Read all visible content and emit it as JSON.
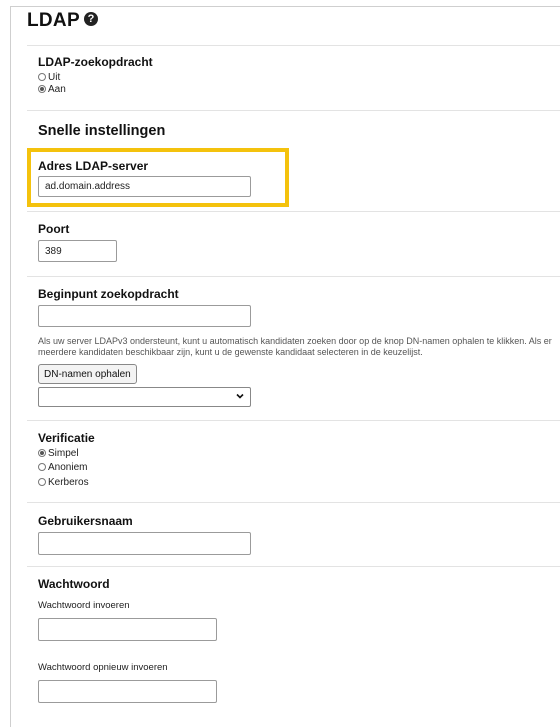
{
  "page": {
    "title": "LDAP"
  },
  "ldap_search": {
    "label": "LDAP-zoekopdracht",
    "options": [
      {
        "label": "Uit",
        "selected": false
      },
      {
        "label": "Aan",
        "selected": true
      }
    ]
  },
  "quick_settings": {
    "heading": "Snelle instellingen"
  },
  "server": {
    "label": "Adres LDAP-server",
    "value": "ad.domain.address",
    "highlight_color": "#f4c20d"
  },
  "port": {
    "label": "Poort",
    "value": "389"
  },
  "search_root": {
    "label": "Beginpunt zoekopdracht",
    "value": "",
    "help": "Als uw server LDAPv3 ondersteunt, kunt u automatisch kandidaten zoeken door op de knop DN-namen ophalen te klikken. Als er meerdere kandidaten beschikbaar zijn, kunt u de gewenste kandidaat selecteren in de keuzelijst.",
    "button_label": "DN-namen ophalen",
    "select_value": ""
  },
  "authentication": {
    "label": "Verificatie",
    "options": [
      {
        "label": "Simpel",
        "selected": true
      },
      {
        "label": "Anoniem",
        "selected": false
      },
      {
        "label": "Kerberos",
        "selected": false
      }
    ]
  },
  "username": {
    "label": "Gebruikersnaam",
    "value": ""
  },
  "password": {
    "label": "Wachtwoord",
    "enter_label": "Wachtwoord invoeren",
    "enter_value": "",
    "repeat_label": "Wachtwoord opnieuw invoeren",
    "repeat_value": ""
  }
}
